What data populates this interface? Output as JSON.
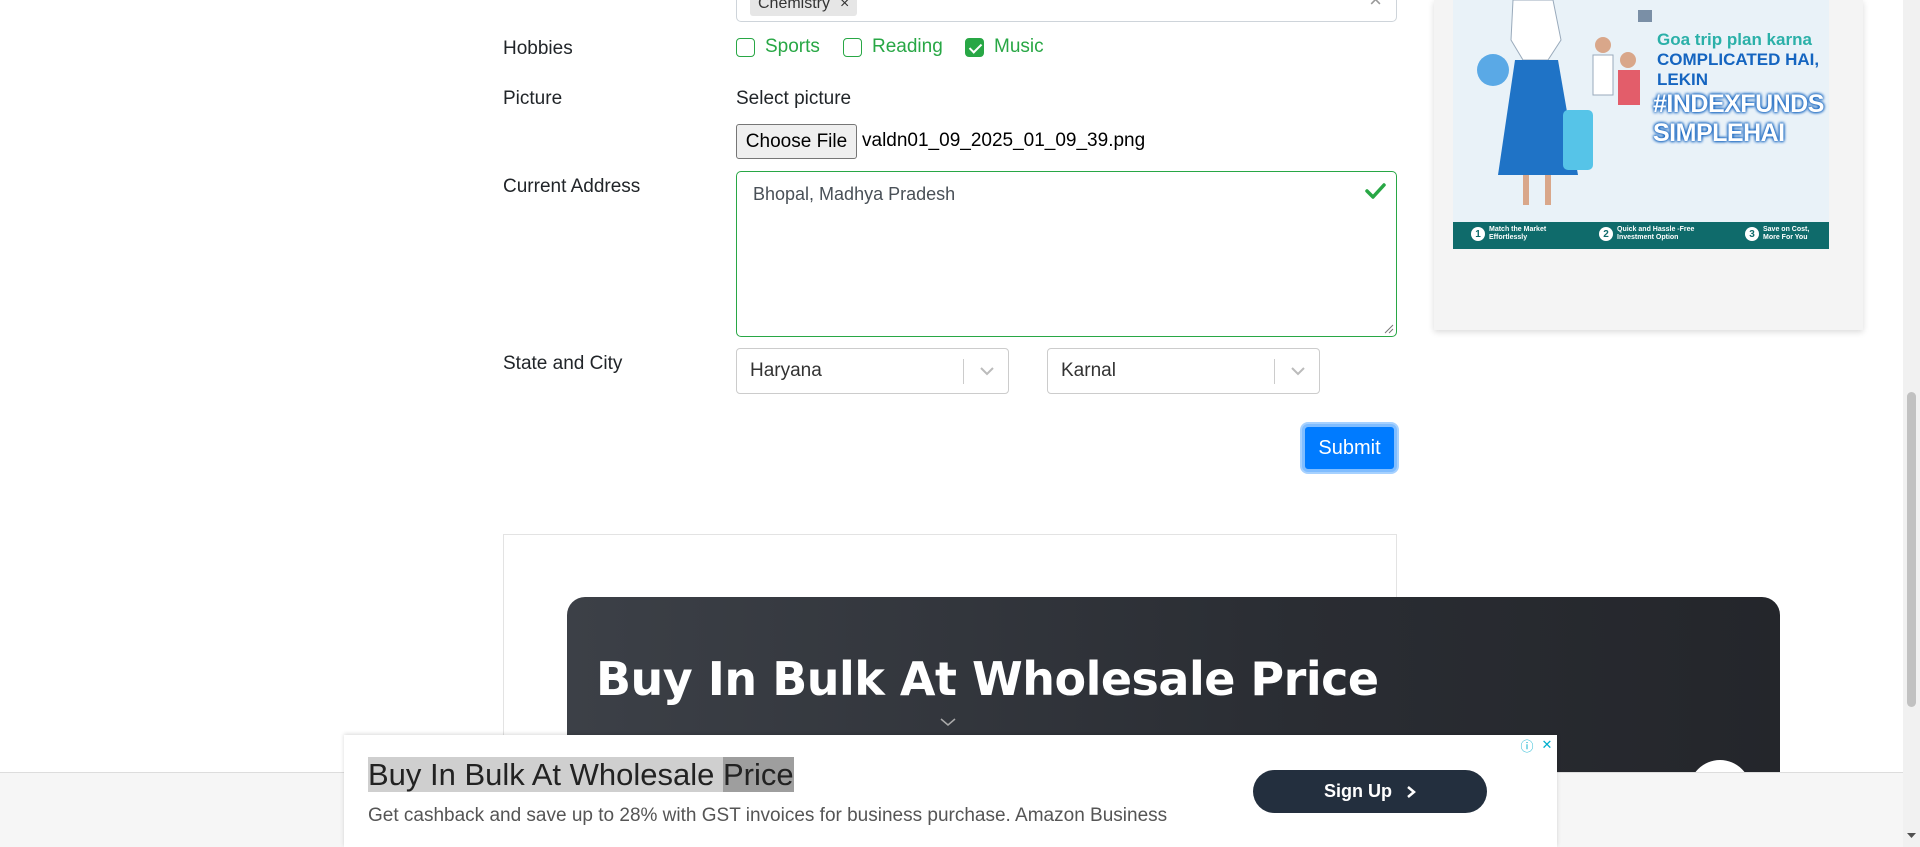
{
  "form": {
    "subjects": {
      "chip": "Chemistry",
      "remove": "×",
      "clear": "×"
    },
    "hobbies": {
      "label": "Hobbies",
      "options": [
        {
          "label": "Sports",
          "checked": false
        },
        {
          "label": "Reading",
          "checked": false
        },
        {
          "label": "Music",
          "checked": true
        }
      ]
    },
    "picture": {
      "label": "Picture",
      "select_text": "Select picture",
      "button": "Choose File",
      "file_name": "valdn01_09_2025_01_09_39.png"
    },
    "address": {
      "label": "Current Address",
      "value": "Bhopal, Madhya Pradesh"
    },
    "state_city": {
      "label": "State and City",
      "state": "Haryana",
      "city": "Karnal"
    },
    "submit": "Submit"
  },
  "side_ad": {
    "line1": "Goa trip plan karna",
    "line2": "COMPLICATED HAI, LEKIN",
    "line3": "#INDEXFUNDS SIMPLEHAI",
    "steps": [
      {
        "num": "1",
        "text": "Match the Market Effortlessly"
      },
      {
        "num": "2",
        "text": "Quick and Hassle -Free Investment Option"
      },
      {
        "num": "3",
        "text": "Save on Cost, More For You"
      }
    ]
  },
  "banner": {
    "title": "Buy In Bulk At Wholesale Price"
  },
  "sticky_ad": {
    "title_a": "Buy In Bulk At Wholesale ",
    "title_b": "Price",
    "subtitle": "Get cashback and save up to 28% with GST invoices for business purchase. Amazon Business",
    "button": "Sign Up",
    "info_icon": "ⓘ",
    "close_icon": "✕"
  },
  "colors": {
    "valid": "#28a745",
    "primary": "#007bff",
    "dark_banner": "#2a2d33",
    "amazon_dark": "#232f3e"
  }
}
